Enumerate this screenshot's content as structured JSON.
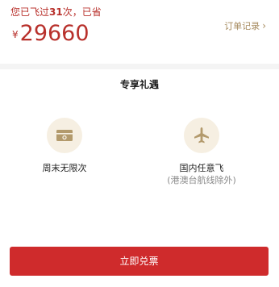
{
  "summary": {
    "flown_prefix": "您已飞过",
    "flown_count": "31",
    "flown_suffix": "次，已省",
    "currency_symbol": "¥",
    "saved_amount": "29660",
    "order_link_label": "订单记录"
  },
  "benefits": {
    "title": "专享礼遇",
    "items": [
      {
        "label": "周末无限次",
        "note": "",
        "icon": "ticket-icon"
      },
      {
        "label": "国内任意飞",
        "note": "(港澳台航线除外)",
        "icon": "airplane-icon"
      }
    ]
  },
  "action": {
    "redeem_label": "立即兑票"
  },
  "colors": {
    "accent_red": "#cf2b2c",
    "text_red": "#b8302b",
    "gold": "#a68a5e",
    "icon_bg": "#f6efe2"
  }
}
